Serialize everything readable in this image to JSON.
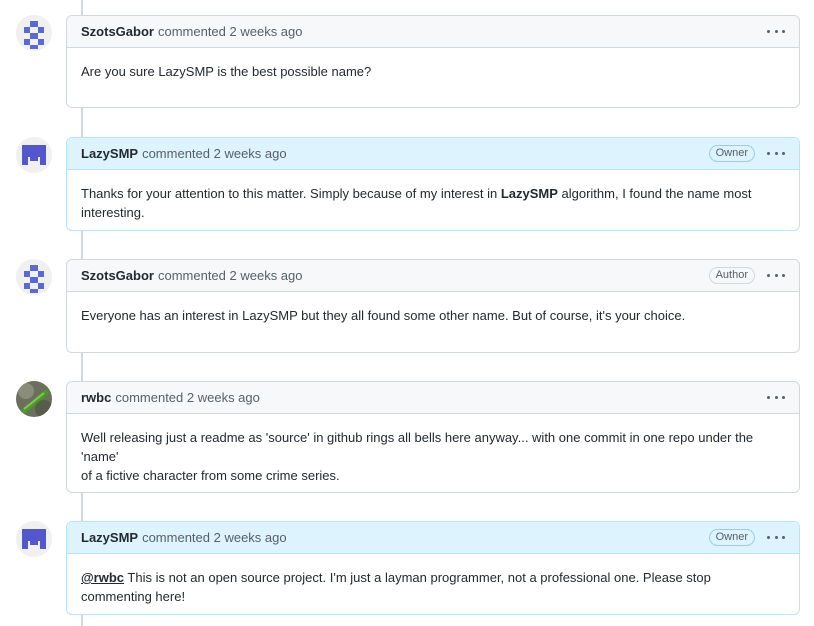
{
  "comments": [
    {
      "author": "SzotsGabor",
      "meta": "commented 2 weeks ago",
      "badge": "",
      "body": "Are you sure LazySMP is the best possible name?"
    },
    {
      "author": "LazySMP",
      "meta": "commented 2 weeks ago",
      "badge": "Owner",
      "body_pre": "Thanks for your attention to this matter. Simply because of my interest in ",
      "body_bold": "LazySMP",
      "body_post": " algorithm, I found the name most interesting."
    },
    {
      "author": "SzotsGabor",
      "meta": "commented 2 weeks ago",
      "badge": "Author",
      "body": "Everyone has an interest in LazySMP but they all found some other name. But of course, it's your choice."
    },
    {
      "author": "rwbc",
      "meta": "commented 2 weeks ago",
      "badge": "",
      "body_line1": "Well releasing just a readme as 'source' in github rings all bells here anyway... with one commit in one repo under the 'name'",
      "body_line2": "of a fictive character from some crime series."
    },
    {
      "author": "LazySMP",
      "meta": "commented 2 weeks ago",
      "badge": "Owner",
      "mention": "@rwbc",
      "body_post": " This is not an open source project. I'm just a layman programmer, not a professional one. Please stop commenting here!"
    }
  ],
  "icons": {
    "kebab": "kebab-horizontal-icon",
    "identicon_szots_color": "#5a6ad0",
    "identicon_lazysmp_color": "#5258cc"
  }
}
